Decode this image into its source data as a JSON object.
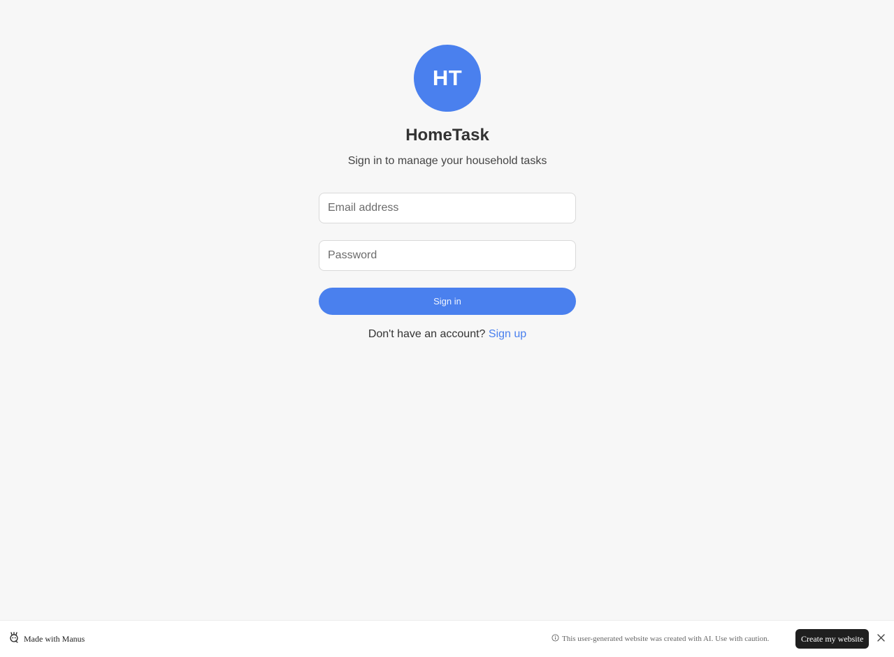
{
  "brand": {
    "logo_initials": "HT",
    "app_name": "HomeTask",
    "tagline": "Sign in to manage your household tasks",
    "accent_color": "#4a80ee"
  },
  "form": {
    "email_placeholder": "Email address",
    "email_value": "",
    "password_placeholder": "Password",
    "password_value": "",
    "signin_label": "Sign in"
  },
  "signup": {
    "prompt": "Don't have an account?",
    "link_label": "Sign up"
  },
  "footer": {
    "made_with": "Made with Manus",
    "made_with_icon": "manus-logo-icon",
    "caution_icon": "info-icon",
    "caution_text": "This user-generated website was created with AI. Use with caution.",
    "create_label": "Create my website",
    "close_icon": "close-icon"
  }
}
